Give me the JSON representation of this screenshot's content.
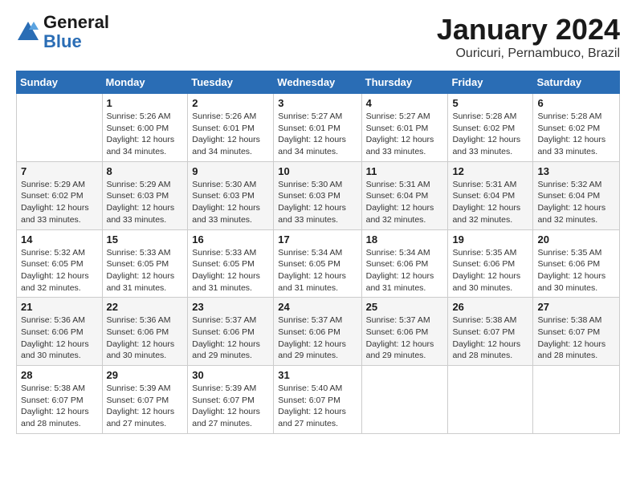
{
  "header": {
    "logo_line1": "General",
    "logo_line2": "Blue",
    "month": "January 2024",
    "location": "Ouricuri, Pernambuco, Brazil"
  },
  "days_of_week": [
    "Sunday",
    "Monday",
    "Tuesday",
    "Wednesday",
    "Thursday",
    "Friday",
    "Saturday"
  ],
  "weeks": [
    [
      {
        "day": "",
        "info": ""
      },
      {
        "day": "1",
        "info": "Sunrise: 5:26 AM\nSunset: 6:00 PM\nDaylight: 12 hours\nand 34 minutes."
      },
      {
        "day": "2",
        "info": "Sunrise: 5:26 AM\nSunset: 6:01 PM\nDaylight: 12 hours\nand 34 minutes."
      },
      {
        "day": "3",
        "info": "Sunrise: 5:27 AM\nSunset: 6:01 PM\nDaylight: 12 hours\nand 34 minutes."
      },
      {
        "day": "4",
        "info": "Sunrise: 5:27 AM\nSunset: 6:01 PM\nDaylight: 12 hours\nand 33 minutes."
      },
      {
        "day": "5",
        "info": "Sunrise: 5:28 AM\nSunset: 6:02 PM\nDaylight: 12 hours\nand 33 minutes."
      },
      {
        "day": "6",
        "info": "Sunrise: 5:28 AM\nSunset: 6:02 PM\nDaylight: 12 hours\nand 33 minutes."
      }
    ],
    [
      {
        "day": "7",
        "info": "Sunrise: 5:29 AM\nSunset: 6:02 PM\nDaylight: 12 hours\nand 33 minutes."
      },
      {
        "day": "8",
        "info": "Sunrise: 5:29 AM\nSunset: 6:03 PM\nDaylight: 12 hours\nand 33 minutes."
      },
      {
        "day": "9",
        "info": "Sunrise: 5:30 AM\nSunset: 6:03 PM\nDaylight: 12 hours\nand 33 minutes."
      },
      {
        "day": "10",
        "info": "Sunrise: 5:30 AM\nSunset: 6:03 PM\nDaylight: 12 hours\nand 33 minutes."
      },
      {
        "day": "11",
        "info": "Sunrise: 5:31 AM\nSunset: 6:04 PM\nDaylight: 12 hours\nand 32 minutes."
      },
      {
        "day": "12",
        "info": "Sunrise: 5:31 AM\nSunset: 6:04 PM\nDaylight: 12 hours\nand 32 minutes."
      },
      {
        "day": "13",
        "info": "Sunrise: 5:32 AM\nSunset: 6:04 PM\nDaylight: 12 hours\nand 32 minutes."
      }
    ],
    [
      {
        "day": "14",
        "info": "Sunrise: 5:32 AM\nSunset: 6:05 PM\nDaylight: 12 hours\nand 32 minutes."
      },
      {
        "day": "15",
        "info": "Sunrise: 5:33 AM\nSunset: 6:05 PM\nDaylight: 12 hours\nand 31 minutes."
      },
      {
        "day": "16",
        "info": "Sunrise: 5:33 AM\nSunset: 6:05 PM\nDaylight: 12 hours\nand 31 minutes."
      },
      {
        "day": "17",
        "info": "Sunrise: 5:34 AM\nSunset: 6:05 PM\nDaylight: 12 hours\nand 31 minutes."
      },
      {
        "day": "18",
        "info": "Sunrise: 5:34 AM\nSunset: 6:06 PM\nDaylight: 12 hours\nand 31 minutes."
      },
      {
        "day": "19",
        "info": "Sunrise: 5:35 AM\nSunset: 6:06 PM\nDaylight: 12 hours\nand 30 minutes."
      },
      {
        "day": "20",
        "info": "Sunrise: 5:35 AM\nSunset: 6:06 PM\nDaylight: 12 hours\nand 30 minutes."
      }
    ],
    [
      {
        "day": "21",
        "info": "Sunrise: 5:36 AM\nSunset: 6:06 PM\nDaylight: 12 hours\nand 30 minutes."
      },
      {
        "day": "22",
        "info": "Sunrise: 5:36 AM\nSunset: 6:06 PM\nDaylight: 12 hours\nand 30 minutes."
      },
      {
        "day": "23",
        "info": "Sunrise: 5:37 AM\nSunset: 6:06 PM\nDaylight: 12 hours\nand 29 minutes."
      },
      {
        "day": "24",
        "info": "Sunrise: 5:37 AM\nSunset: 6:06 PM\nDaylight: 12 hours\nand 29 minutes."
      },
      {
        "day": "25",
        "info": "Sunrise: 5:37 AM\nSunset: 6:06 PM\nDaylight: 12 hours\nand 29 minutes."
      },
      {
        "day": "26",
        "info": "Sunrise: 5:38 AM\nSunset: 6:07 PM\nDaylight: 12 hours\nand 28 minutes."
      },
      {
        "day": "27",
        "info": "Sunrise: 5:38 AM\nSunset: 6:07 PM\nDaylight: 12 hours\nand 28 minutes."
      }
    ],
    [
      {
        "day": "28",
        "info": "Sunrise: 5:38 AM\nSunset: 6:07 PM\nDaylight: 12 hours\nand 28 minutes."
      },
      {
        "day": "29",
        "info": "Sunrise: 5:39 AM\nSunset: 6:07 PM\nDaylight: 12 hours\nand 27 minutes."
      },
      {
        "day": "30",
        "info": "Sunrise: 5:39 AM\nSunset: 6:07 PM\nDaylight: 12 hours\nand 27 minutes."
      },
      {
        "day": "31",
        "info": "Sunrise: 5:40 AM\nSunset: 6:07 PM\nDaylight: 12 hours\nand 27 minutes."
      },
      {
        "day": "",
        "info": ""
      },
      {
        "day": "",
        "info": ""
      },
      {
        "day": "",
        "info": ""
      }
    ]
  ]
}
